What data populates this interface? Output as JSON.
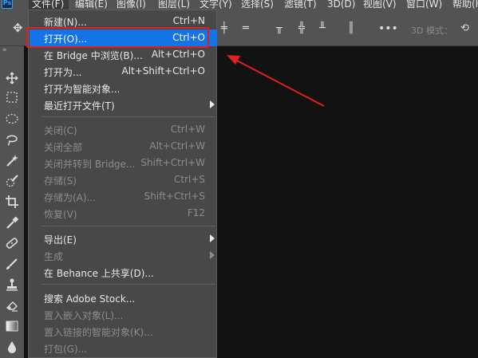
{
  "app": {
    "logo_text": "Ps"
  },
  "menubar": {
    "items": [
      {
        "label": "文件(F)",
        "active": true
      },
      {
        "label": "编辑(E)"
      },
      {
        "label": "图像(I)"
      },
      {
        "label": "图层(L)"
      },
      {
        "label": "文字(Y)"
      },
      {
        "label": "选择(S)"
      },
      {
        "label": "滤镜(T)"
      },
      {
        "label": "3D(D)"
      },
      {
        "label": "视图(V)"
      },
      {
        "label": "窗口(W)"
      },
      {
        "label": "帮助(H)"
      }
    ]
  },
  "optionsbar": {
    "mode_label": "3D 模式："
  },
  "file_menu": {
    "items": [
      {
        "label": "新建(N)...",
        "shortcut": "Ctrl+N",
        "enabled": true
      },
      {
        "label": "打开(O)...",
        "shortcut": "Ctrl+O",
        "enabled": true,
        "highlighted": true
      },
      {
        "label": "在 Bridge 中浏览(B)...",
        "shortcut": "Alt+Ctrl+O",
        "enabled": true
      },
      {
        "label": "打开为...",
        "shortcut": "Alt+Shift+Ctrl+O",
        "enabled": true
      },
      {
        "label": "打开为智能对象...",
        "shortcut": "",
        "enabled": true
      },
      {
        "label": "最近打开文件(T)",
        "shortcut": "",
        "enabled": true,
        "submenu": true
      },
      {
        "label": "关闭(C)",
        "shortcut": "Ctrl+W",
        "enabled": false
      },
      {
        "label": "关闭全部",
        "shortcut": "Alt+Ctrl+W",
        "enabled": false
      },
      {
        "label": "关闭并转到 Bridge...",
        "shortcut": "Shift+Ctrl+W",
        "enabled": false
      },
      {
        "label": "存储(S)",
        "shortcut": "Ctrl+S",
        "enabled": false
      },
      {
        "label": "存储为(A)...",
        "shortcut": "Shift+Ctrl+S",
        "enabled": false
      },
      {
        "label": "恢复(V)",
        "shortcut": "F12",
        "enabled": false
      },
      {
        "label": "导出(E)",
        "shortcut": "",
        "enabled": true,
        "submenu": true
      },
      {
        "label": "生成",
        "shortcut": "",
        "enabled": false,
        "submenu": true
      },
      {
        "label": "在 Behance 上共享(D)...",
        "shortcut": "",
        "enabled": true
      },
      {
        "label": "搜索 Adobe Stock...",
        "shortcut": "",
        "enabled": true
      },
      {
        "label": "置入嵌入对象(L)...",
        "shortcut": "",
        "enabled": false
      },
      {
        "label": "置入链接的智能对象(K)...",
        "shortcut": "",
        "enabled": false
      },
      {
        "label": "打包(G)...",
        "shortcut": "",
        "enabled": false
      }
    ]
  },
  "tools": [
    {
      "name": "move-tool-icon"
    },
    {
      "name": "marquee-tool-icon"
    },
    {
      "name": "ellipse-marquee-tool-icon"
    },
    {
      "name": "lasso-tool-icon"
    },
    {
      "name": "magic-wand-tool-icon"
    },
    {
      "name": "quick-selection-tool-icon"
    },
    {
      "name": "crop-tool-icon"
    },
    {
      "name": "eyedropper-tool-icon"
    },
    {
      "name": "healing-brush-tool-icon"
    },
    {
      "name": "brush-tool-icon"
    },
    {
      "name": "clone-stamp-tool-icon"
    },
    {
      "name": "eraser-tool-icon"
    },
    {
      "name": "gradient-tool-icon"
    },
    {
      "name": "blur-tool-icon"
    }
  ],
  "colors": {
    "highlight": "#1473e6",
    "annotation": "#e0201b",
    "menu_bg": "#484848",
    "panel_bg": "#535353",
    "canvas_bg": "#121212"
  }
}
